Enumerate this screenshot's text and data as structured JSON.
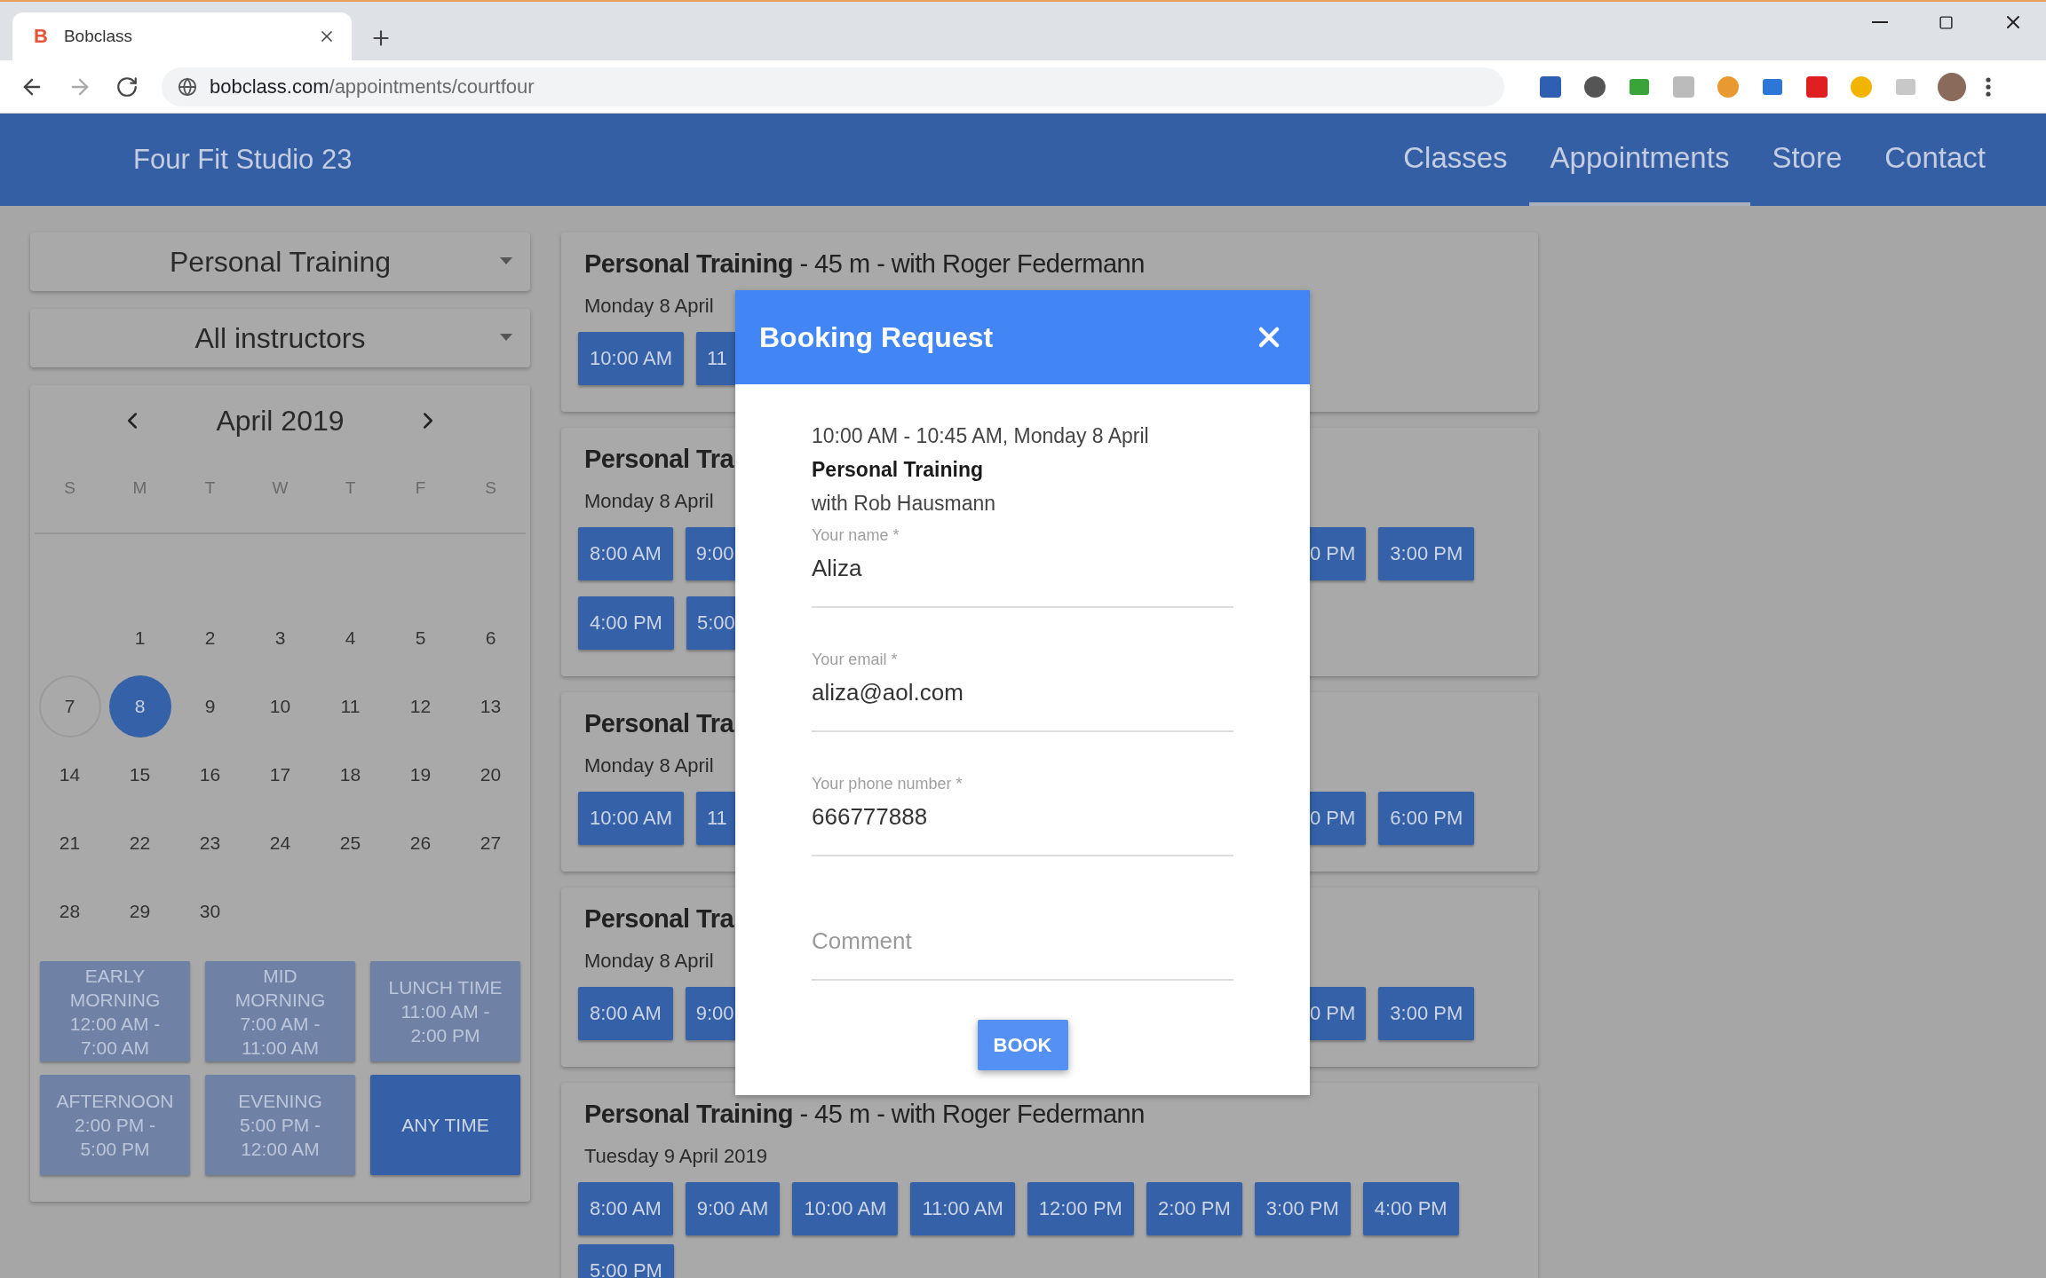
{
  "browser": {
    "tab": {
      "favicon": "B",
      "title": "Bobclass"
    },
    "url": {
      "host": "bobclass.com",
      "path": "/appointments/courtfour"
    }
  },
  "header": {
    "brand": "Four Fit Studio 23",
    "nav": [
      {
        "label": "Classes",
        "selected": false
      },
      {
        "label": "Appointments",
        "selected": true
      },
      {
        "label": "Store",
        "selected": false
      },
      {
        "label": "Contact",
        "selected": false
      }
    ]
  },
  "filters": {
    "class_type": "Personal Training",
    "instructor": "All instructors"
  },
  "calendar": {
    "month": "April 2019",
    "weekdays": [
      "S",
      "M",
      "T",
      "W",
      "T",
      "F",
      "S"
    ],
    "weeks": [
      [
        {
          "label": "1",
          "today": false,
          "selected": false
        },
        {
          "label": "2",
          "today": false,
          "selected": false
        },
        {
          "label": "3",
          "today": false,
          "selected": false
        },
        {
          "label": "4",
          "today": false,
          "selected": false
        },
        {
          "label": "5",
          "today": false,
          "selected": false
        },
        {
          "label": "6",
          "today": false,
          "selected": false
        }
      ],
      [
        {
          "label": "7",
          "today": true,
          "selected": false
        },
        {
          "label": "8",
          "today": false,
          "selected": true
        },
        {
          "label": "9",
          "today": false,
          "selected": false
        },
        {
          "label": "10",
          "today": false,
          "selected": false
        },
        {
          "label": "11",
          "today": false,
          "selected": false
        },
        {
          "label": "12",
          "today": false,
          "selected": false
        },
        {
          "label": "13",
          "today": false,
          "selected": false
        }
      ],
      [
        {
          "label": "14",
          "today": false,
          "selected": false
        },
        {
          "label": "15",
          "today": false,
          "selected": false
        },
        {
          "label": "16",
          "today": false,
          "selected": false
        },
        {
          "label": "17",
          "today": false,
          "selected": false
        },
        {
          "label": "18",
          "today": false,
          "selected": false
        },
        {
          "label": "19",
          "today": false,
          "selected": false
        },
        {
          "label": "20",
          "today": false,
          "selected": false
        }
      ],
      [
        {
          "label": "21",
          "today": false,
          "selected": false
        },
        {
          "label": "22",
          "today": false,
          "selected": false
        },
        {
          "label": "23",
          "today": false,
          "selected": false
        },
        {
          "label": "24",
          "today": false,
          "selected": false
        },
        {
          "label": "25",
          "today": false,
          "selected": false
        },
        {
          "label": "26",
          "today": false,
          "selected": false
        },
        {
          "label": "27",
          "today": false,
          "selected": false
        }
      ],
      [
        {
          "label": "28",
          "today": false,
          "selected": false
        },
        {
          "label": "29",
          "today": false,
          "selected": false
        },
        {
          "label": "30",
          "today": false,
          "selected": false
        }
      ]
    ]
  },
  "time_ranges": [
    {
      "name": "EARLY MORNING",
      "range": "12:00 AM - 7:00 AM",
      "selected": false
    },
    {
      "name": "MID MORNING",
      "range": "7:00 AM - 11:00 AM",
      "selected": false
    },
    {
      "name": "LUNCH TIME",
      "range": "11:00 AM - 2:00 PM",
      "selected": false
    },
    {
      "name": "AFTERNOON",
      "range": "2:00 PM - 5:00 PM",
      "selected": false
    },
    {
      "name": "EVENING",
      "range": "5:00 PM - 12:00 AM",
      "selected": false
    },
    {
      "name": "ANY TIME",
      "selected": true
    }
  ],
  "sessions": [
    {
      "kind": "split",
      "title": "**Personal Training** - 45 m - with Roger Federmann",
      "date": "Monday 8 April",
      "rows": [
        {
          "left": [
            {
              "label": "10:00 AM",
              "kind": "full"
            },
            {
              "label": "11",
              "kind": "cut_right"
            }
          ],
          "right": []
        }
      ]
    },
    {
      "kind": "split",
      "title": "**Personal Tra**",
      "date": "Monday 8 April",
      "rows": [
        {
          "left": [
            {
              "label": "8:00 AM",
              "kind": "full"
            },
            {
              "label": "9:00",
              "kind": "cut_right"
            }
          ],
          "right": [
            {
              "label": "0 PM",
              "kind": "cut_left"
            },
            {
              "label": "3:00 PM",
              "kind": "full"
            }
          ]
        },
        {
          "left": [
            {
              "label": "4:00 PM",
              "kind": "full"
            },
            {
              "label": "5:00",
              "kind": "cut_right"
            }
          ],
          "right": []
        }
      ]
    },
    {
      "kind": "split",
      "title": "**Personal Tra**",
      "date": "Monday 8 April",
      "rows": [
        {
          "left": [
            {
              "label": "10:00 AM",
              "kind": "full"
            },
            {
              "label": "11",
              "kind": "cut_right"
            }
          ],
          "right": [
            {
              "label": "0 PM",
              "kind": "cut_left"
            },
            {
              "label": "6:00 PM",
              "kind": "full"
            }
          ]
        }
      ]
    },
    {
      "kind": "split",
      "title": "**Personal Tra**",
      "date": "Monday 8 April",
      "rows": [
        {
          "left": [
            {
              "label": "8:00 AM",
              "kind": "full"
            },
            {
              "label": "9:00",
              "kind": "cut_right"
            }
          ],
          "right": [
            {
              "label": "0 PM",
              "kind": "cut_left"
            },
            {
              "label": "3:00 PM",
              "kind": "full"
            }
          ]
        }
      ]
    },
    {
      "kind": "open",
      "title": "**Personal Training** - 45 m - with Roger Federmann",
      "date": "Tuesday 9 April 2019",
      "slots": [
        "8:00 AM",
        "9:00 AM",
        "10:00 AM",
        "11:00 AM",
        "12:00 PM",
        "2:00 PM",
        "3:00 PM",
        "4:00 PM",
        "5:00 PM"
      ]
    }
  ],
  "dialog": {
    "title": "Booking Request",
    "summary": {
      "time": "10:00 AM - 10:45 AM, Monday 8 April",
      "class": "Personal Training",
      "instructor": "with Rob Hausmann"
    },
    "fields": [
      {
        "label": "Your name *",
        "value": "Aliza"
      },
      {
        "label": "Your email *",
        "value": "aliza@aol.com"
      },
      {
        "label": "Your phone number *",
        "value": "666777888"
      },
      {
        "placeholder": "Comment"
      }
    ],
    "submit": "BOOK"
  }
}
